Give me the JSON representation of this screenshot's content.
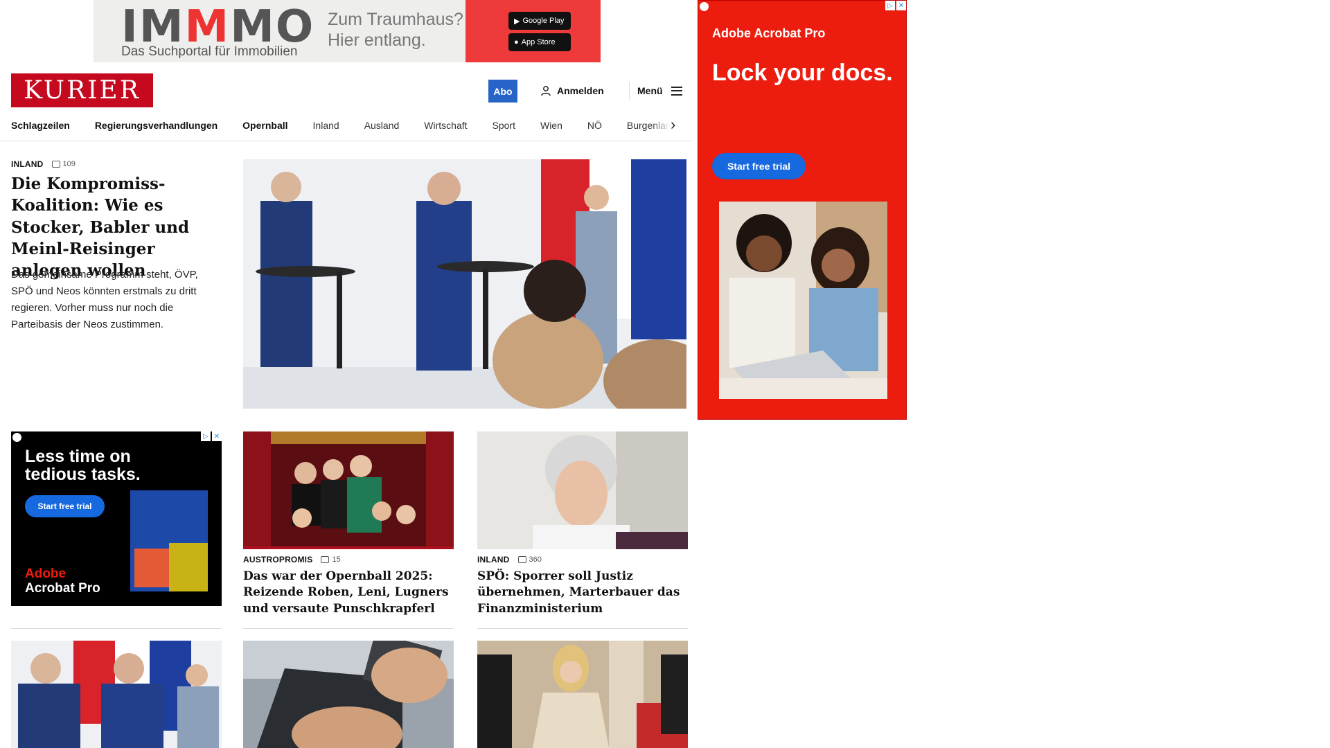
{
  "top_ad": {
    "brand_a": "IM",
    "brand_m": "M",
    "brand_b": "MO",
    "tagline": "Das Suchportal für Immobilien",
    "claim_line1": "Zum Traumhaus?",
    "claim_line2": "Hier entlang.",
    "google_play": "Google Play",
    "app_store": "App Store"
  },
  "header": {
    "logo": "KURIER",
    "abo": "Abo",
    "login": "Anmelden",
    "menu": "Menü"
  },
  "nav": {
    "items": [
      "Schlagzeilen",
      "Regierungsverhandlungen",
      "Opernball",
      "Inland",
      "Ausland",
      "Wirtschaft",
      "Sport",
      "Wien",
      "NÖ",
      "Burgenland"
    ]
  },
  "lead": {
    "kicker": "INLAND",
    "comments": "109",
    "title": "Die Kompromiss-Koalition: Wie es Stocker, Babler und Meinl-Reisinger anlegen wollen",
    "text": "Das gemeinsame Programm steht, ÖVP, SPÖ und Neos könnten erstmals zu dritt regieren. Vorher muss nur noch die Parteibasis der Neos zustimmen."
  },
  "side_ad": {
    "brand_adobe": "Adobe",
    "brand_product": "Acrobat Pro",
    "headline": "Lock your docs.",
    "cta": "Start free trial"
  },
  "small_ad": {
    "headline_line1": "Less time on",
    "headline_line2": "tedious tasks.",
    "cta": "Start free trial",
    "brand1": "Adobe",
    "brand2": "Acrobat Pro"
  },
  "cards": [
    {
      "kicker": "AUSTROPROMIS",
      "comments": "15",
      "title": "Das war der Opernball 2025: Reizende Roben, Leni, Lugners und versaute Punschkrapferl"
    },
    {
      "kicker": "INLAND",
      "comments": "360",
      "title": "SPÖ: Sporrer soll Justiz übernehmen, Marterbauer das Finanzministerium"
    }
  ]
}
